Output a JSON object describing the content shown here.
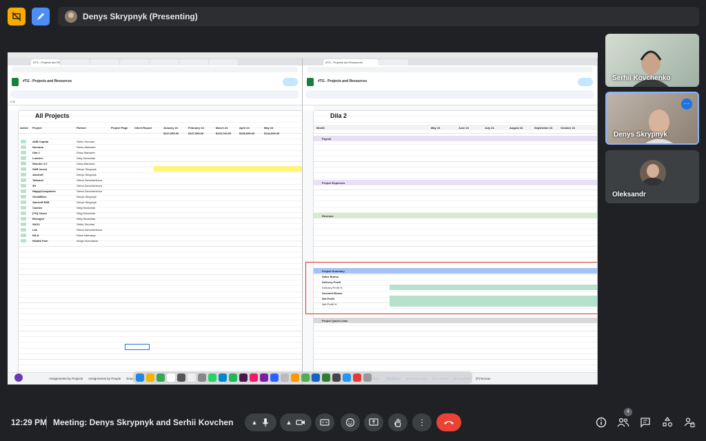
{
  "presenter": {
    "name": "Denys Skrypnyk (Presenting)"
  },
  "participants": [
    {
      "name": "Serhii Kovchenko"
    },
    {
      "name": "Denys Skrypnyk"
    },
    {
      "name": "Oleksandr"
    }
  ],
  "participant_count": "4",
  "bottom": {
    "time": "12:29 PM",
    "meeting": "Meeting: Denys Skrypnyk and Serhii Kovchenko | S..."
  },
  "share": {
    "left": {
      "doc_title": "#TG - Projects and Resources",
      "sheet_title": "All Projects",
      "cell_ref": "F26",
      "headers": [
        "Active",
        "Project",
        "Partner",
        "Project Page",
        "Client Report",
        "January 24",
        "February 24",
        "March 24",
        "April 24",
        "May 24"
      ],
      "rows": [
        [
          "ANB Capital",
          "Oleks Shuman"
        ],
        [
          "Norvana",
          "Denis Afanasev"
        ],
        [
          "Dila 2",
          "Dima Afanasev"
        ],
        [
          "Lumiere",
          "Oleg Savsohan"
        ],
        [
          "Wonder 3.0",
          "Dima Afanasev"
        ],
        [
          "SAB Invest",
          "Denys Skrypnyk"
        ],
        [
          "Adstruff",
          "Denys Skrypnyk"
        ],
        [
          "Takamol",
          "Olena Zamchenkova"
        ],
        [
          "3H",
          "Olena Zamchenkova"
        ],
        [
          "HappyCompanies",
          "Olena Zamchenkova"
        ],
        [
          "OmniBiton",
          "Denys Skrypnyk"
        ],
        [
          "Aamroff B2B",
          "Denys Skrypnyk"
        ],
        [
          "Cashex",
          "Oleg Savsohan"
        ],
        [
          "[TG] Cases",
          "Oleg Savsohan"
        ],
        [
          "Renogen",
          "Oleg Savsohan"
        ],
        [
          "SASV",
          "Oleks Shuman"
        ],
        [
          "Lilo",
          "Olena Zamchenkova"
        ],
        [
          "DILA",
          "Dima Kalenskyi"
        ],
        [
          "Wealth Fam",
          "Serge Victoriause"
        ]
      ],
      "totals": [
        "$127,990.00",
        "$127,990.00",
        "$123,740.00",
        "$169,690.00",
        "$144,060.00"
      ],
      "tabs": [
        "Assignments by Projects",
        "Assignments by People",
        "Employee Details",
        "Dima Afl Calendar",
        "Employees"
      ]
    },
    "right": {
      "doc_title": "#TG - Projects and Resources",
      "sheet_title": "Dila 2",
      "months": [
        "Month",
        "May 24",
        "June 24",
        "July 24",
        "August 24",
        "September 24",
        "October 24"
      ],
      "summary_title": "Project Summary",
      "summary_rows": [
        "Sales Bonus",
        "Delivery Profit",
        "Delivery Profit %",
        "Account Bonus",
        "Net Profit",
        "Net Profit %"
      ],
      "section_labels": [
        "Payroll",
        "Project Expenses",
        "Revenue",
        "Project Quick Links"
      ],
      "tabs": [
        "[P] ANB Capital",
        "[P] Adstroff B2B",
        "[P] Dila 2",
        "[P] SAB Invest",
        "[P] Lumiere",
        "[P] Approval",
        "[P] Norvan"
      ]
    }
  },
  "colors": {
    "accent_green": "#b7e1cd",
    "accent_yellow": "#fff475",
    "red_box": "#d93025",
    "hangup": "#ea4335"
  }
}
